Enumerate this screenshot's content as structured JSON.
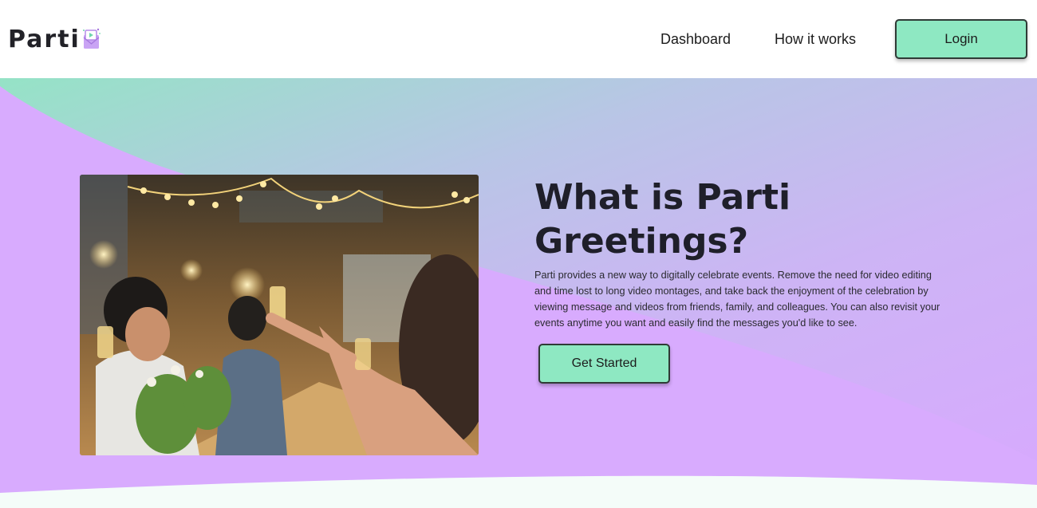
{
  "header": {
    "logo_text": "Parti",
    "nav": {
      "dashboard": "Dashboard",
      "how_it_works": "How it works"
    },
    "login_label": "Login"
  },
  "hero": {
    "title": "What is Parti Greetings?",
    "description": "Parti provides a new way to digitally celebrate events. Remove the need for video editing and time lost to long video montages, and take back the enjoyment of the celebration by viewing message and videos from friends, family, and colleagues. You can also revisit your events anytime you want and easily find the messages you'd like to see.",
    "cta_label": "Get Started",
    "photo_icon": "celebration-toast-photo"
  },
  "colors": {
    "accent_green": "#8ee8c2",
    "hero_purple": "#d7aaff",
    "hero_mint": "#9fdfc9",
    "text_dark": "#1f1f2a"
  }
}
